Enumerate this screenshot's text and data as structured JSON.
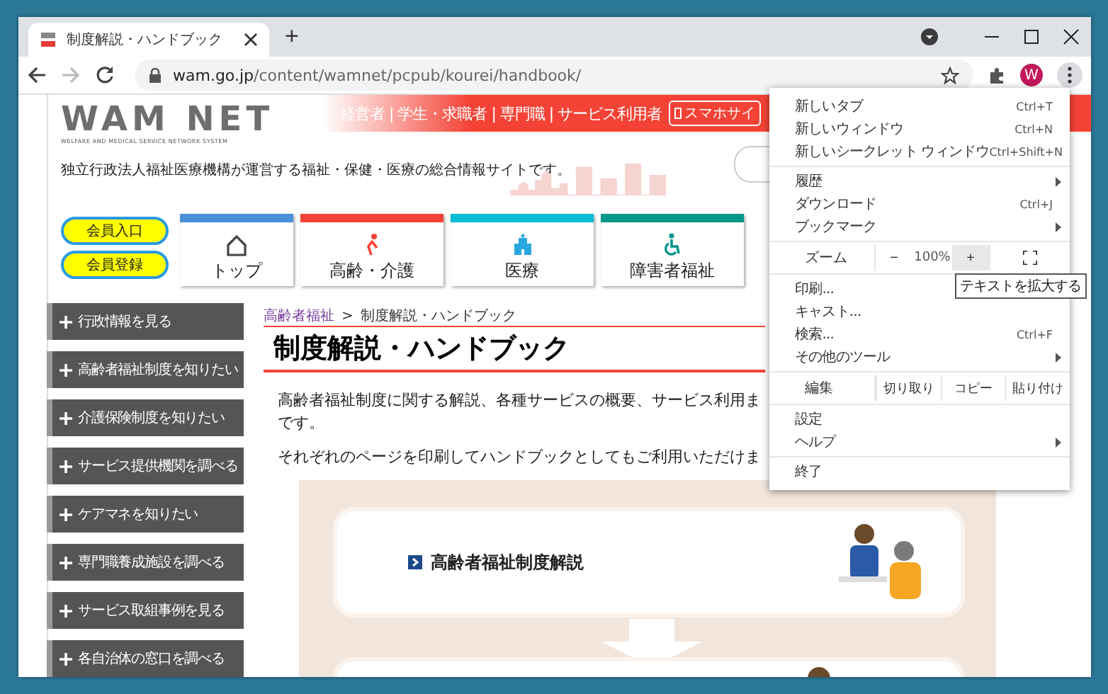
{
  "window": {
    "tab_title": "制度解説・ハンドブック",
    "new_tab": "+"
  },
  "address_bar": {
    "domain": "wam.go.jp",
    "path": "/content/wamnet/pcpub/kourei/handbook/"
  },
  "profile": {
    "initial": "W"
  },
  "site": {
    "logo": "WAM NET",
    "logo_tagline": "WELFARE AND MEDICAL SERVICE NETWORK SYSTEM",
    "description": "独立行政法人福祉医療機構が運営する福祉・保健・医療の総合情報サイトです。",
    "audience_links": "経営者 | 学生・求職者 | 専門職 | サービス利用者",
    "mobile_link": "スマホサイ",
    "member_buttons": [
      "会員入口",
      "会員登録"
    ],
    "nav_tabs": [
      {
        "label": "トップ",
        "color": "#4a90d9"
      },
      {
        "label": "高齢・介護",
        "color": "#f44336"
      },
      {
        "label": "医療",
        "color": "#00bcd4"
      },
      {
        "label": "障害者福祉",
        "color": "#009688"
      }
    ]
  },
  "sidebar": {
    "items": [
      "行政情報を見る",
      "高齢者福祉制度を知りたい",
      "介護保険制度を知りたい",
      "サービス提供機関を調べる",
      "ケアマネを知りたい",
      "専門職養成施設を調べる",
      "サービス取組事例を見る",
      "各自治体の窓口を調べる"
    ]
  },
  "content": {
    "breadcrumb": [
      "高齢者福祉",
      "制度解説・ハンドブック"
    ],
    "breadcrumb_separator": ">",
    "heading": "制度解説・ハンドブック",
    "paragraphs": [
      {
        "lines": [
          "高齢者福祉制度に関する解説、各種サービスの概要、サービス利用ま",
          "です。"
        ]
      },
      {
        "lines": [
          "それぞれのページを印刷してハンドブックとしてもご利用いただけま"
        ]
      }
    ],
    "cards": [
      "高齢者福祉制度解説"
    ]
  },
  "menu": {
    "sections": [
      {
        "kind": "items",
        "items": [
          {
            "label": "新しいタブ",
            "shortcut": "Ctrl+T"
          },
          {
            "label": "新しいウィンドウ",
            "shortcut": "Ctrl+N"
          },
          {
            "label": "新しいシークレット ウィンドウ",
            "shortcut": "Ctrl+Shift+N"
          }
        ]
      },
      {
        "kind": "items",
        "items": [
          {
            "label": "履歴",
            "submenu": true
          },
          {
            "label": "ダウンロード",
            "shortcut": "Ctrl+J"
          },
          {
            "label": "ブックマーク",
            "submenu": true
          }
        ]
      },
      {
        "kind": "zoom",
        "label": "ズーム",
        "minus": "−",
        "value": "100%",
        "plus": "+",
        "plus_hovered": true
      },
      {
        "kind": "items",
        "items": [
          {
            "label": "印刷..."
          },
          {
            "label": "キャスト..."
          },
          {
            "label": "検索...",
            "shortcut": "Ctrl+F"
          },
          {
            "label": "その他のツール",
            "submenu": true
          }
        ]
      },
      {
        "kind": "edit",
        "label": "編集",
        "buttons": [
          "切り取り",
          "コピー",
          "貼り付け"
        ]
      },
      {
        "kind": "items",
        "items": [
          {
            "label": "設定"
          },
          {
            "label": "ヘルプ",
            "submenu": true
          }
        ]
      },
      {
        "kind": "items",
        "items": [
          {
            "label": "終了"
          }
        ]
      }
    ]
  },
  "tooltip": "テキストを拡大する"
}
